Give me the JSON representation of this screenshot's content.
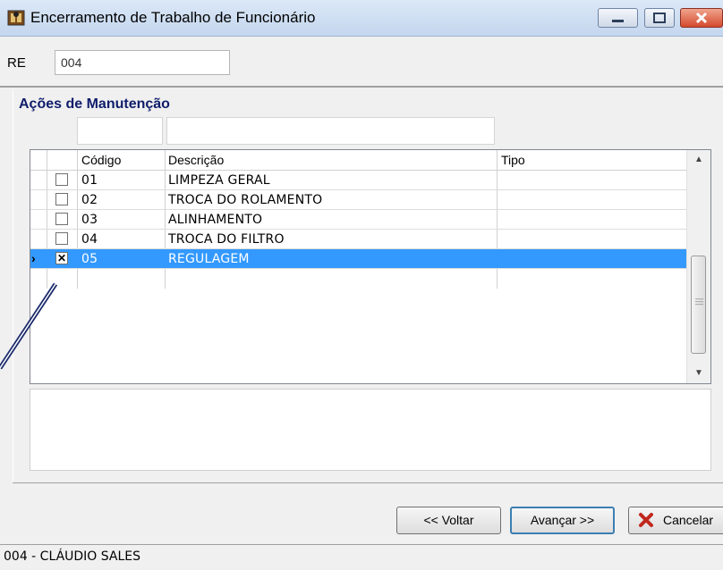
{
  "window": {
    "title": "Encerramento de Trabalho de Funcionário"
  },
  "re": {
    "label": "RE",
    "value": "004"
  },
  "section": {
    "title": "Ações de Manutenção"
  },
  "grid": {
    "columns": [
      "Código",
      "Descrição",
      "Tipo"
    ],
    "rows": [
      {
        "checked": false,
        "selected": false,
        "indicator": "",
        "codigo": "01",
        "descricao": "LIMPEZA GERAL",
        "tipo": ""
      },
      {
        "checked": false,
        "selected": false,
        "indicator": "",
        "codigo": "02",
        "descricao": "TROCA DO ROLAMENTO",
        "tipo": ""
      },
      {
        "checked": false,
        "selected": false,
        "indicator": "",
        "codigo": "03",
        "descricao": "ALINHAMENTO",
        "tipo": ""
      },
      {
        "checked": false,
        "selected": false,
        "indicator": "",
        "codigo": "04",
        "descricao": "TROCA DO FILTRO",
        "tipo": ""
      },
      {
        "checked": true,
        "selected": true,
        "indicator": "›",
        "codigo": "05",
        "descricao": "REGULAGEM",
        "tipo": ""
      }
    ]
  },
  "buttons": {
    "voltar": "<< Voltar",
    "avancar": "Avançar >>",
    "cancelar": "Cancelar"
  },
  "status": {
    "text": "004 - CLÁUDIO SALES"
  },
  "colors": {
    "selection": "#3399ff",
    "section_title": "#0f1d6b",
    "annotation": "#1a2a6c"
  },
  "icons": [
    "app-icon",
    "minimize-icon",
    "maximize-icon",
    "close-icon",
    "scroll-up-icon",
    "scroll-down-icon",
    "cancel-x-icon"
  ]
}
